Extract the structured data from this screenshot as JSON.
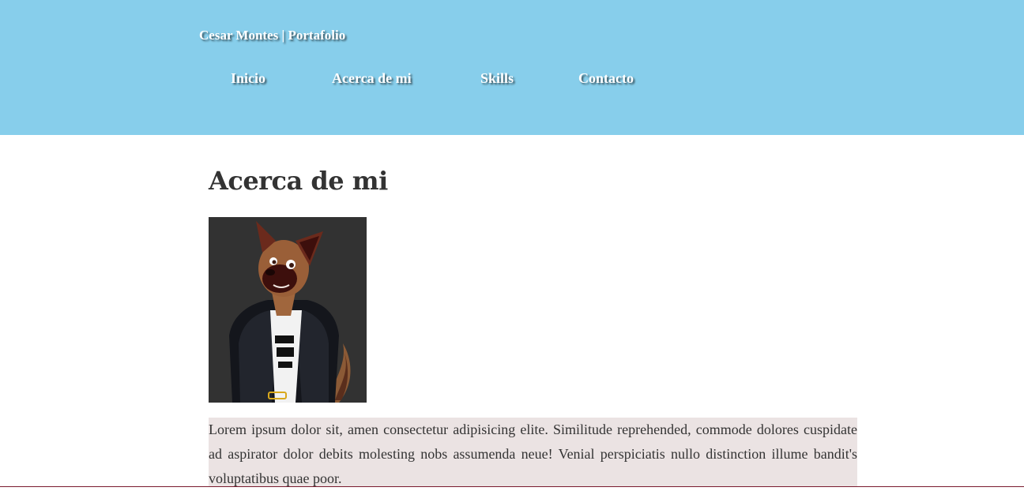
{
  "header": {
    "site_title": "Cesar Montes | Portafolio",
    "nav": [
      {
        "label": "Inicio"
      },
      {
        "label": "Acerca de mi"
      },
      {
        "label": "Skills"
      },
      {
        "label": "Contacto"
      }
    ],
    "background_color": "#87ceeb"
  },
  "main": {
    "title": "Acerca de mi",
    "avatar": {
      "icon": "illustrated-dog-character-in-jacket"
    },
    "bio": "Lorem ipsum dolor sit, amen consectetur adipisicing elite. Similitude reprehended, commode dolores cuspidate ad aspirator dolor debits molesting nobs assumenda neue! Venial perspiciatis nullo distinction illume bandit's voluptatibus quae poor."
  }
}
